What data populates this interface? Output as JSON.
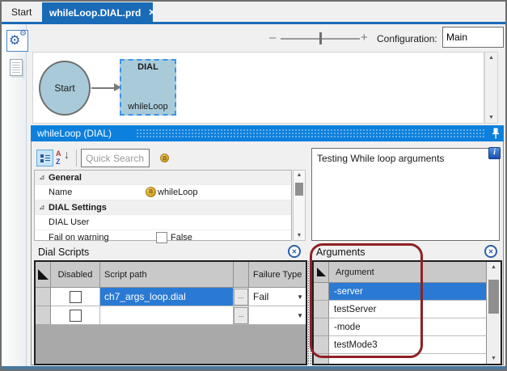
{
  "colors": {
    "tab_blue": "#1a6bb7",
    "titlebar_blue": "#0c80dc",
    "selection_blue": "#2a7ad4",
    "node_fill": "#a9cbd9",
    "node_selected_border": "#3c95e8",
    "annotation_red": "#8f2123"
  },
  "tabs": {
    "start": "Start",
    "active": "whileLoop.DIAL.prd",
    "close": "✕"
  },
  "toolbar": {
    "zoom_out": "–",
    "zoom_in": "+",
    "configuration_label": "Configuration:",
    "configuration_value": "Main"
  },
  "canvas": {
    "start_node_label": "Start",
    "node_type_label": "DIAL",
    "node_name_label": "whileLoop"
  },
  "panel": {
    "title": "whileLoop (DIAL)"
  },
  "property_grid": {
    "quick_search_placeholder": "Quick Search",
    "category_general": "General",
    "name_label": "Name",
    "name_value": "whileLoop",
    "category_dial_settings": "DIAL Settings",
    "dial_user_label": "DIAL User",
    "dial_user_value": "",
    "fail_on_warning_label": "Fail on warning",
    "fail_on_warning_value": "False",
    "expander": "⊿"
  },
  "description": {
    "text": "Testing While loop arguments",
    "info_glyph": "i"
  },
  "dial_scripts": {
    "title": "Dial Scripts",
    "col_disabled": "Disabled",
    "col_script_path": "Script path",
    "col_failure_type": "Failure Type",
    "rows": [
      {
        "script_path": "ch7_args_loop.dial",
        "failure_type": "Fail",
        "browse": "...",
        "selected": true
      },
      {
        "script_path": "",
        "failure_type": "",
        "browse": "...",
        "selected": false
      }
    ]
  },
  "arguments": {
    "title": "Arguments",
    "col_argument": "Argument",
    "rows": [
      "-server",
      "testServer",
      "-mode",
      "testMode3",
      ""
    ]
  }
}
